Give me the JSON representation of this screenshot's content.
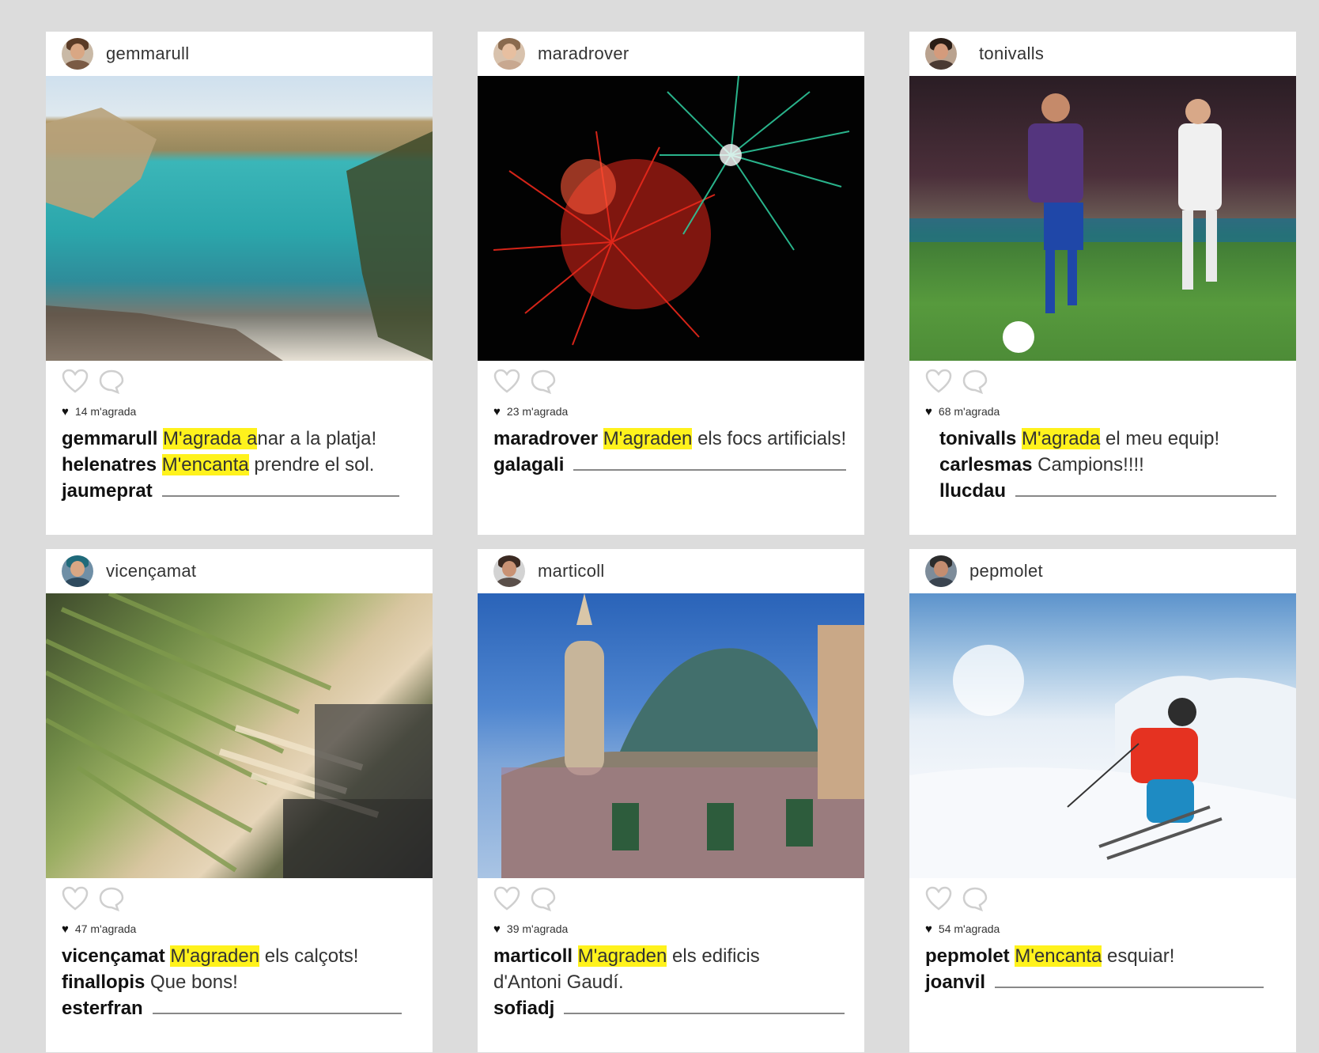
{
  "posts": [
    {
      "user": "gemmarull",
      "likes": "14 m'agrada",
      "comments": [
        {
          "user": "gemmarull",
          "hl": "M'agrada a",
          "rest": "nar a la platja!"
        },
        {
          "user": "helenatres",
          "hl": "M'encanta",
          "rest": " prendre el sol."
        },
        {
          "user": "jaumeprat",
          "hl": "",
          "rest": ""
        }
      ]
    },
    {
      "user": "maradrover",
      "likes": "23 m'agrada",
      "comments": [
        {
          "user": "maradrover",
          "hl": "M'agraden",
          "rest": " els focs artificials!"
        },
        {
          "user": "galagali",
          "hl": "",
          "rest": ""
        }
      ]
    },
    {
      "user": "tonivalls",
      "likes": "68 m'agrada",
      "comments": [
        {
          "user": "tonivalls",
          "hl": "M'agrada",
          "rest": " el meu equip!"
        },
        {
          "user": "carlesmas",
          "hl": "",
          "rest": "Campions!!!!"
        },
        {
          "user": "llucdau",
          "hl": "",
          "rest": ""
        }
      ]
    },
    {
      "user": "vicençamat",
      "likes": "47 m'agrada",
      "comments": [
        {
          "user": "vicençamat",
          "hl": "M'agraden",
          "rest": " els calçots!"
        },
        {
          "user": "finallopis",
          "hl": "",
          "rest": "Que bons!"
        },
        {
          "user": "esterfran",
          "hl": "",
          "rest": ""
        }
      ]
    },
    {
      "user": "marticoll",
      "likes": "39 m'agrada",
      "comments": [
        {
          "user": "marticoll",
          "hl": "M'agraden",
          "rest": " els edificis"
        },
        {
          "user": "",
          "hl": "",
          "rest": "d'Antoni Gaudí."
        },
        {
          "user": "sofiadj",
          "hl": "",
          "rest": ""
        }
      ]
    },
    {
      "user": "pepmolet",
      "likes": "54 m'agrada",
      "comments": [
        {
          "user": "pepmolet",
          "hl": "M'encanta",
          "rest": " esquiar!"
        },
        {
          "user": "joanvil",
          "hl": "",
          "rest": ""
        }
      ]
    }
  ],
  "icons": {
    "like": "heart-outline-icon",
    "comment": "speech-bubble-icon",
    "likes_count": "heart-filled-icon"
  },
  "colors": {
    "highlight": "#fff21c",
    "background": "#dcdcdc",
    "card": "#ffffff"
  }
}
